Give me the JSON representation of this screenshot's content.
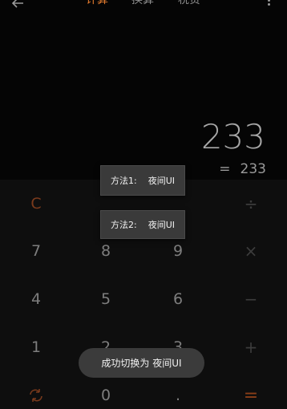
{
  "header": {
    "back_icon": "back-arrow-icon",
    "tabs": [
      {
        "label": "计算",
        "active": true
      },
      {
        "label": "换算",
        "active": false
      },
      {
        "label": "税贷",
        "active": false
      }
    ],
    "more_icon": "more-vertical-icon"
  },
  "display": {
    "result": "233",
    "expression_eq": "=",
    "expression_value": "233"
  },
  "keypad": {
    "clear": "C",
    "divide": "÷",
    "k7": "7",
    "k8": "8",
    "k9": "9",
    "multiply": "×",
    "k4": "4",
    "k5": "5",
    "k6": "6",
    "minus": "−",
    "k1": "1",
    "k2": "2",
    "k3": "3",
    "plus": "+",
    "k0": "0",
    "dot": ".",
    "equals": "=",
    "switch_icon": "switch-mode-icon"
  },
  "popups": [
    {
      "label": "方法1:",
      "value": "夜间UI"
    },
    {
      "label": "方法2:",
      "value": "夜间UI"
    }
  ],
  "toast": {
    "message": "成功切换为 夜间UI"
  },
  "colors": {
    "accent": "#e07a2e",
    "background": "#050505"
  }
}
